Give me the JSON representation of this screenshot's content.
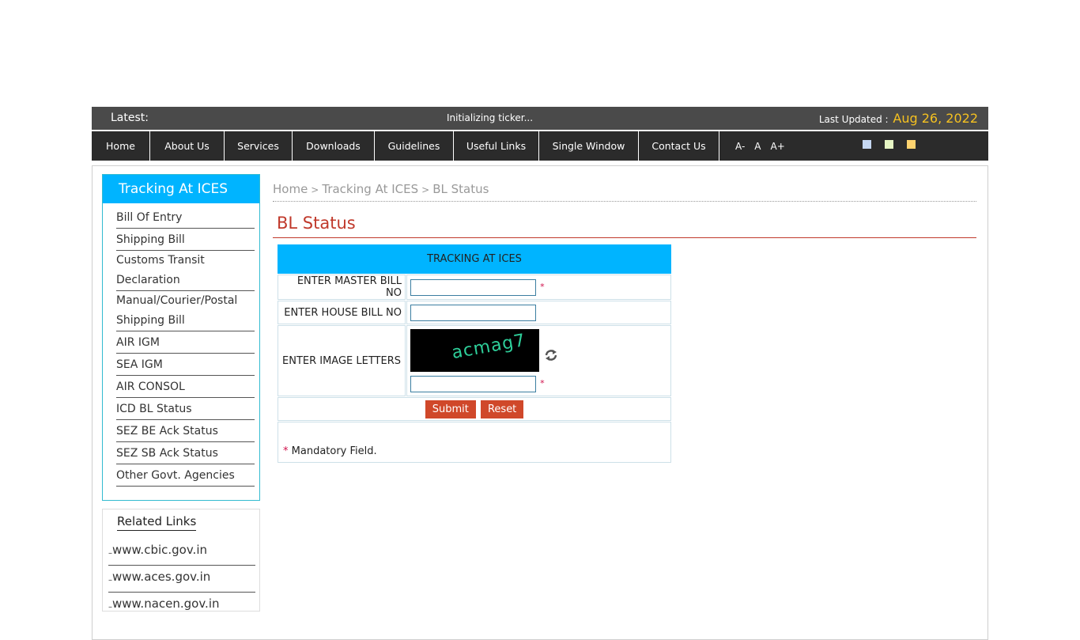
{
  "ticker": {
    "latest_label": "Latest:",
    "ticker_text": "Initializing ticker...",
    "last_updated_label": "Last Updated :",
    "last_updated_date": "Aug 26, 2022"
  },
  "nav": {
    "items": [
      {
        "label": "Home"
      },
      {
        "label": "About Us"
      },
      {
        "label": "Services"
      },
      {
        "label": "Downloads"
      },
      {
        "label": "Guidelines"
      },
      {
        "label": "Useful Links"
      },
      {
        "label": "Single Window"
      },
      {
        "label": "Contact Us"
      }
    ],
    "font_controls": [
      "A-",
      "A",
      "A+"
    ],
    "theme_colors": [
      "#c5d7f2",
      "#e6f5c4",
      "#fdd36f"
    ]
  },
  "sidebar": {
    "title": "Tracking At ICES",
    "items": [
      {
        "label": "Bill Of Entry"
      },
      {
        "label": "Shipping Bill"
      },
      {
        "label": "Customs Transit Declaration"
      },
      {
        "label": "Manual/Courier/Postal Shipping Bill"
      },
      {
        "label": "AIR IGM"
      },
      {
        "label": "SEA IGM"
      },
      {
        "label": "AIR CONSOL"
      },
      {
        "label": "ICD BL Status"
      },
      {
        "label": "SEZ BE Ack Status"
      },
      {
        "label": "SEZ SB Ack Status"
      },
      {
        "label": "Other Govt. Agencies"
      }
    ]
  },
  "related": {
    "title": "Related Links",
    "items": [
      {
        "label": "www.cbic.gov.in"
      },
      {
        "label": "www.aces.gov.in"
      },
      {
        "label": "www.nacen.gov.in"
      }
    ]
  },
  "breadcrumb": {
    "items": [
      "Home",
      "Tracking At ICES",
      "BL Status"
    ],
    "separator": ">"
  },
  "page": {
    "title": "BL Status"
  },
  "form": {
    "header": "TRACKING AT ICES",
    "master_bill_label": "ENTER MASTER BILL NO",
    "master_bill_value": "",
    "house_bill_label": "ENTER HOUSE BILL NO",
    "house_bill_value": "",
    "image_letters_label": "ENTER IMAGE LETTERS",
    "captcha_text": "acmag7",
    "captcha_value": "",
    "required_mark": "*",
    "submit_label": "Submit",
    "reset_label": "Reset",
    "mandatory_note": "Mandatory Field."
  },
  "colors": {
    "accent_blue": "#00b4ff",
    "title_red": "#c0392b",
    "button_red": "#d0482a",
    "date_gold": "#f5c120"
  }
}
